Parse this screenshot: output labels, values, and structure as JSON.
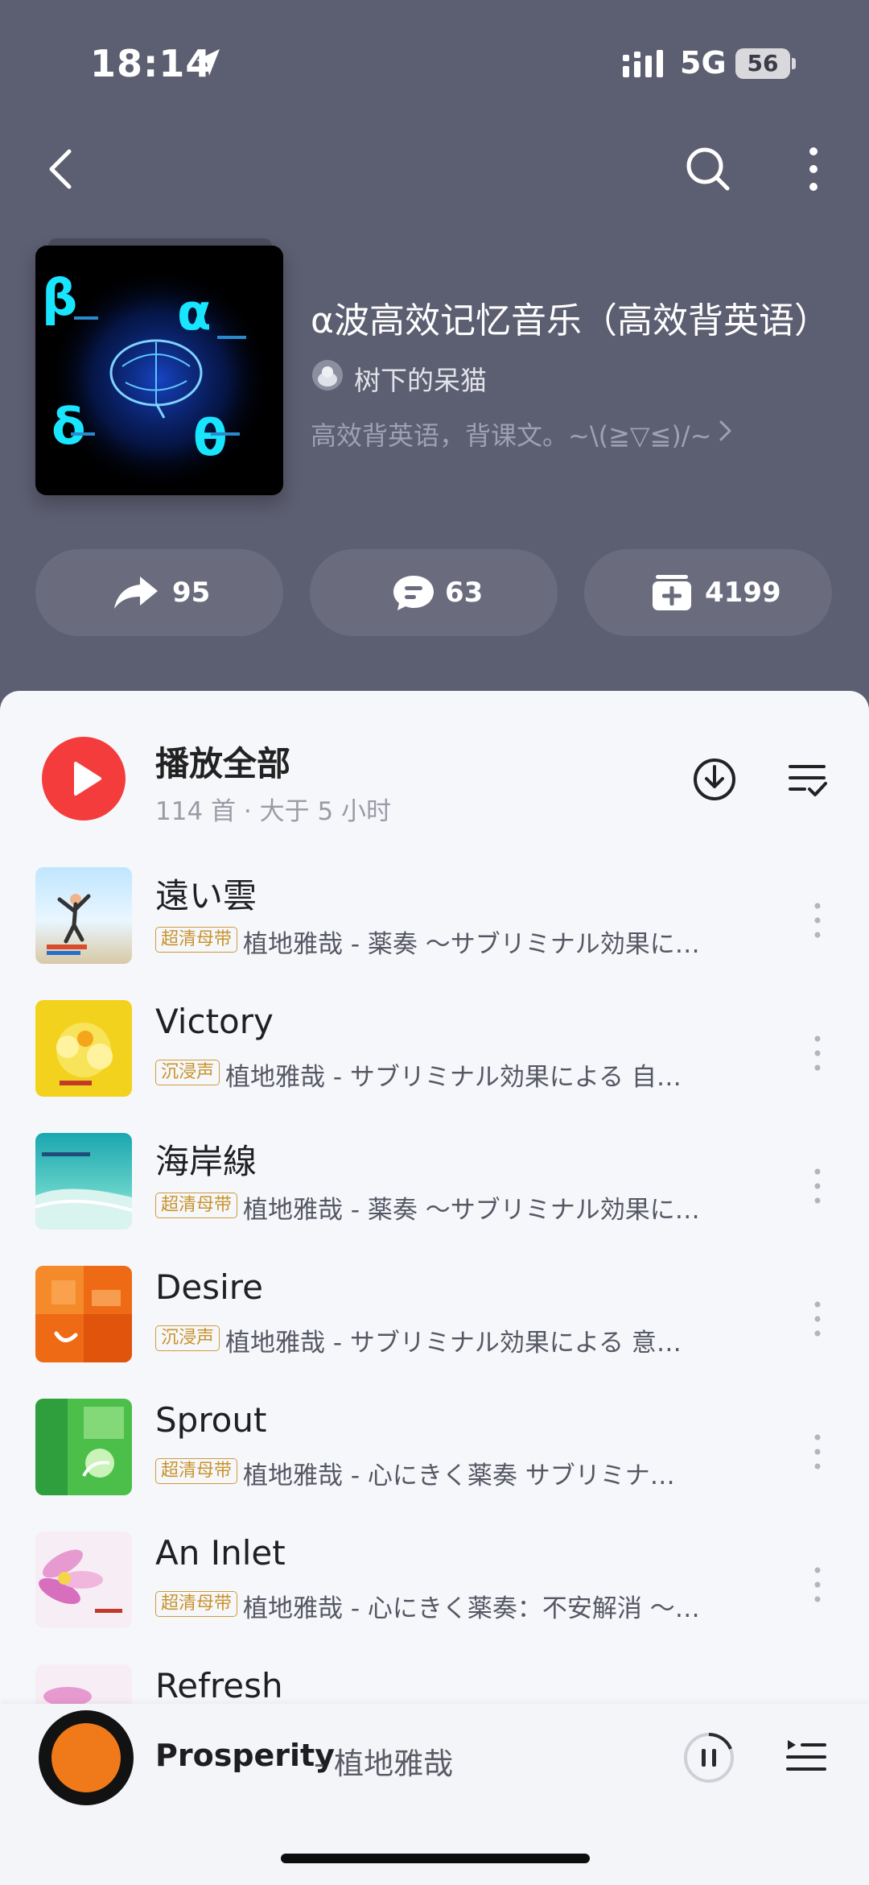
{
  "status_bar": {
    "time": "18:14",
    "network": "5G",
    "battery": "56"
  },
  "playlist": {
    "title": "α波高效记忆音乐（高效背英语）",
    "creator": "树下的呆猫",
    "description": "高效背英语，背课文。~\\(≧▽≦)/~",
    "cover_labels": {
      "beta": "β",
      "alpha": "α",
      "delta": "δ",
      "theta": "θ"
    }
  },
  "actions": {
    "share_count": "95",
    "comment_count": "63",
    "collect_count": "4199"
  },
  "play_all": {
    "label": "播放全部",
    "meta": "114 首 · 大于 5 小时"
  },
  "songs": [
    {
      "title": "遠い雲",
      "badge": "超清母带",
      "subtitle": "植地雅哉 - 薬奏 ～サブリミナル効果に…"
    },
    {
      "title": "Victory",
      "badge": "沉浸声",
      "subtitle": "植地雅哉 - サブリミナル効果による 自…"
    },
    {
      "title": "海岸線",
      "badge": "超清母带",
      "subtitle": "植地雅哉 - 薬奏 ～サブリミナル効果に…"
    },
    {
      "title": "Desire",
      "badge": "沉浸声",
      "subtitle": "植地雅哉 - サブリミナル効果による 意…"
    },
    {
      "title": "Sprout",
      "badge": "超清母带",
      "subtitle": "植地雅哉 - 心にきく薬奏 サブリミナ…"
    },
    {
      "title": "An Inlet",
      "badge": "超清母带",
      "subtitle": "植地雅哉 - 心にきく薬奏：不安解消 ～…"
    },
    {
      "title": "Refresh",
      "badge": "",
      "subtitle": ""
    }
  ],
  "now_playing": {
    "title": "Prosperity",
    "artist": "- 植地雅哉"
  },
  "colors": {
    "header_bg": "#5c5e71",
    "accent_red": "#f43c3c",
    "badge_gold": "#cf9b3a"
  },
  "icons": [
    "location-arrow-icon",
    "signal-icon",
    "back-icon",
    "search-icon",
    "more-icon",
    "share-icon",
    "comment-icon",
    "collect-icon",
    "play-icon",
    "download-icon",
    "manage-list-icon",
    "pause-icon",
    "queue-icon"
  ]
}
